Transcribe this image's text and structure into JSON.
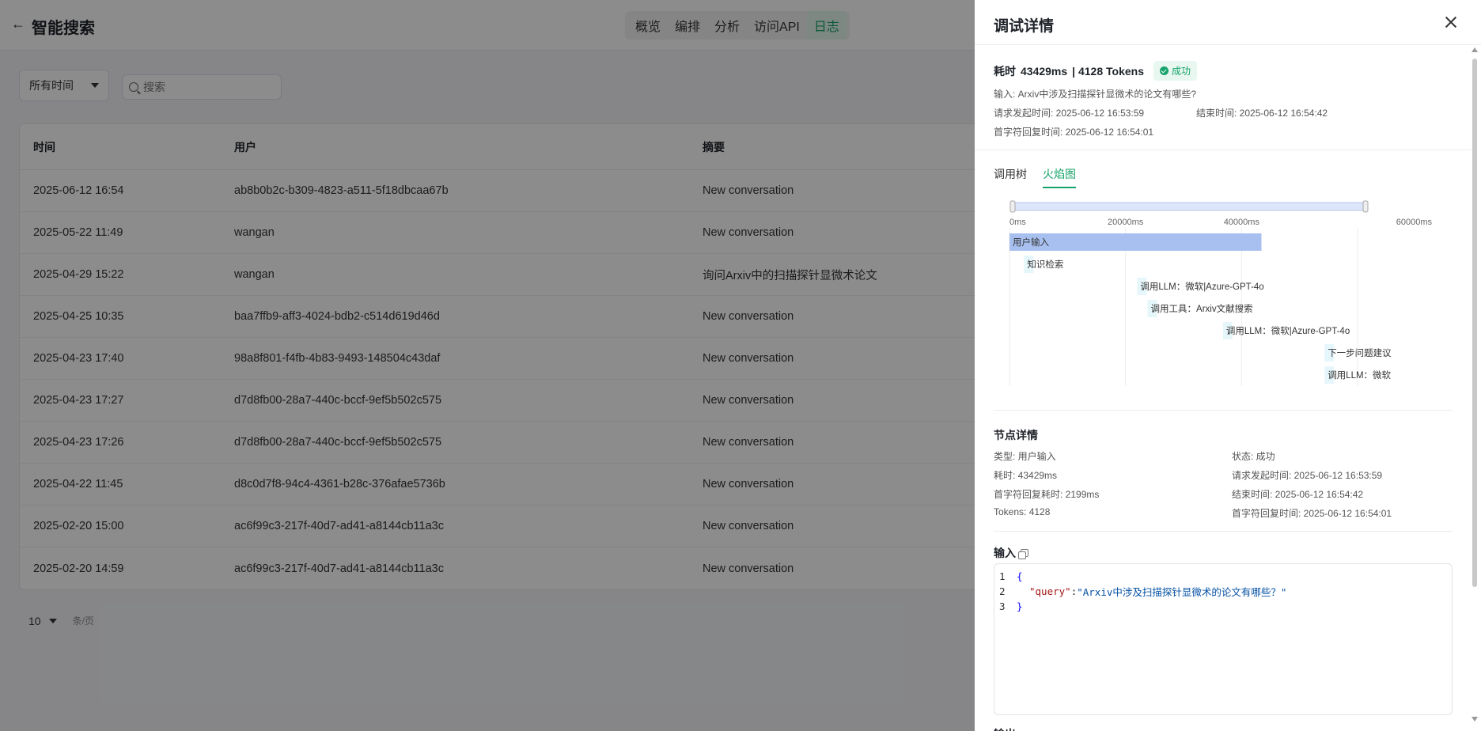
{
  "header": {
    "back_icon": "←",
    "title": "智能搜索",
    "tabs": [
      {
        "label": "概览",
        "active": false
      },
      {
        "label": "编排",
        "active": false
      },
      {
        "label": "分析",
        "active": false
      },
      {
        "label": "访问API",
        "active": false
      },
      {
        "label": "日志",
        "active": true
      }
    ]
  },
  "filters": {
    "time_select": "所有时间",
    "search_placeholder": "搜索"
  },
  "table": {
    "columns": [
      "时间",
      "用户",
      "摘要"
    ],
    "rows": [
      {
        "time": "2025-06-12 16:54",
        "user": "ab8b0b2c-b309-4823-a511-5f18dbcaa67b",
        "summary": "New conversation"
      },
      {
        "time": "2025-05-22 11:49",
        "user": "wangan",
        "summary": "New conversation"
      },
      {
        "time": "2025-04-29 15:22",
        "user": "wangan",
        "summary": "询问Arxiv中的扫描探针显微术论文"
      },
      {
        "time": "2025-04-25 10:35",
        "user": "baa7ffb9-aff3-4024-bdb2-c514d619d46d",
        "summary": "New conversation"
      },
      {
        "time": "2025-04-23 17:40",
        "user": "98a8f801-f4fb-4b83-9493-148504c43daf",
        "summary": "New conversation"
      },
      {
        "time": "2025-04-23 17:27",
        "user": "d7d8fb00-28a7-440c-bccf-9ef5b502c575",
        "summary": "New conversation"
      },
      {
        "time": "2025-04-23 17:26",
        "user": "d7d8fb00-28a7-440c-bccf-9ef5b502c575",
        "summary": "New conversation"
      },
      {
        "time": "2025-04-22 11:45",
        "user": "d8c0d7f8-94c4-4361-b28c-376afae5736b",
        "summary": "New conversation"
      },
      {
        "time": "2025-02-20 15:00",
        "user": "ac6f99c3-217f-40d7-ad41-a8144cb11a3c",
        "summary": "New conversation"
      },
      {
        "time": "2025-02-20 14:59",
        "user": "ac6f99c3-217f-40d7-ad41-a8144cb11a3c",
        "summary": "New conversation"
      }
    ]
  },
  "pager": {
    "page_size": "10",
    "unit": "条/页"
  },
  "drawer": {
    "title": "调试详情",
    "summary": {
      "elapsed_label": "耗时",
      "elapsed": "43429ms",
      "tokens": "| 4128 Tokens",
      "status": "成功",
      "input": "输入: Arxiv中涉及扫描探针显微术的论文有哪些?",
      "request_time": "请求发起时间: 2025-06-12 16:53:59",
      "end_time": "结束时间: 2025-06-12 16:54:42",
      "first_token_time": "首字符回复时间: 2025-06-12 16:54:01"
    },
    "subtabs": [
      {
        "label": "调用树",
        "active": false
      },
      {
        "label": "火焰图",
        "active": true
      }
    ],
    "flame": {
      "axis_ticks": [
        "0ms",
        "20000ms",
        "40000ms",
        "60000ms"
      ],
      "axis_values": [
        0,
        20000,
        40000,
        60000
      ],
      "bars": [
        {
          "label": "用户输入",
          "start": 0,
          "duration": 43429
        },
        {
          "label": "知识检索",
          "start": 2500,
          "duration": 200
        },
        {
          "label": "调用LLM：微软|Azure-GPT-4o",
          "start": 22000,
          "duration": 1200
        },
        {
          "label": "调用工具：Arxiv文献搜索",
          "start": 23800,
          "duration": 800
        },
        {
          "label": "调用LLM：微软|Azure-GPT-4o",
          "start": 36800,
          "duration": 800
        },
        {
          "label": "下一步问题建议",
          "start": 54300,
          "duration": 1500
        },
        {
          "label": "调用LLM：微软",
          "start": 54300,
          "duration": 1500
        }
      ],
      "colors": {
        "main": "#a8c0ef",
        "sub": "#e6f7fb"
      }
    },
    "node": {
      "title": "节点详情",
      "type": "类型: 用户输入",
      "status": "状态: 成功",
      "elapsed": "耗时: 43429ms",
      "request_time": "请求发起时间: 2025-06-12 16:53:59",
      "first_token_elapsed": "首字符回复耗时: 2199ms",
      "end_time": "结束时间: 2025-06-12 16:54:42",
      "tokens": "Tokens: 4128",
      "first_token_time": "首字符回复时间: 2025-06-12 16:54:01"
    },
    "input_title": "输入",
    "code": {
      "line_numbers": [
        "1",
        "2",
        "3"
      ],
      "open": "{",
      "key": "\"query\"",
      "colon": ": ",
      "value": "\"Arxiv中涉及扫描探针显微术的论文有哪些？\"",
      "close": "}"
    },
    "output_title": "输出"
  },
  "colors": {
    "accent": "#16a36b",
    "overlay": "rgba(0,0,0,0.45)"
  }
}
